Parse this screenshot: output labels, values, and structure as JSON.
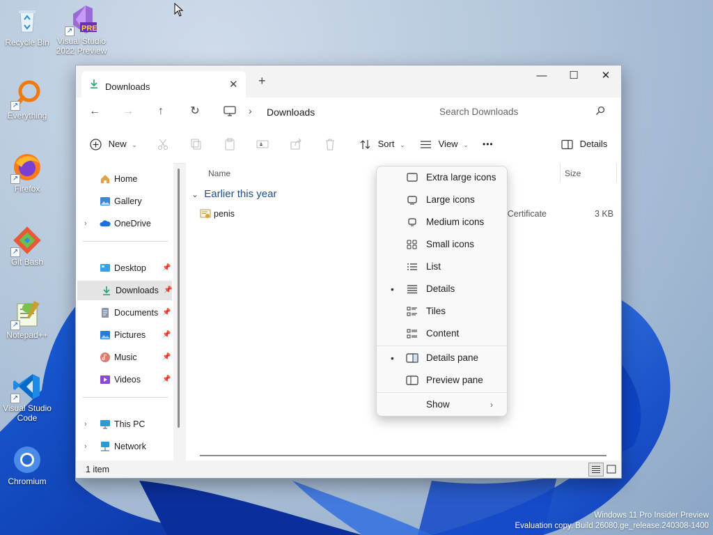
{
  "desktop": {
    "icons": [
      {
        "label": "Recycle Bin",
        "icon": "recycle-bin-icon"
      },
      {
        "label": "Visual Studio 2022 Preview",
        "badge": "PRE",
        "icon": "visual-studio-icon"
      },
      {
        "label": "Everything",
        "icon": "everything-search-icon"
      },
      {
        "label": "Firefox",
        "icon": "firefox-icon"
      },
      {
        "label": "Git Bash",
        "icon": "git-bash-icon"
      },
      {
        "label": "Notepad++",
        "icon": "notepad-plus-plus-icon"
      },
      {
        "label": "Visual Studio Code",
        "icon": "vscode-icon"
      },
      {
        "label": "Chromium",
        "icon": "chromium-icon"
      }
    ],
    "watermark": {
      "line1": "Windows 11 Pro Insider Preview",
      "line2": "Evaluation copy. Build 26080.ge_release.240308-1400"
    }
  },
  "explorer": {
    "tab_title": "Downloads",
    "tab_close": "✕",
    "new_tab": "+",
    "window_controls": {
      "minimize": "—",
      "maximize": "☐",
      "close": "✕"
    },
    "nav": {
      "back": "←",
      "forward": "→",
      "up": "↑",
      "refresh": "↻"
    },
    "address": {
      "separator": "›",
      "path": "Downloads"
    },
    "search": {
      "placeholder": "Search Downloads"
    },
    "commandbar": {
      "new_label": "New",
      "sort_label": "Sort",
      "view_label": "View",
      "more_label": "•••",
      "details_label": "Details",
      "dropdown_chevron": "⌄"
    },
    "sidebar": {
      "pin": "📌",
      "expand": "›",
      "items": [
        {
          "label": "Home",
          "icon": "home-icon"
        },
        {
          "label": "Gallery",
          "icon": "gallery-icon"
        },
        {
          "label": "OneDrive",
          "icon": "onedrive-icon"
        },
        {
          "label": "Desktop",
          "icon": "desktop-folder-icon"
        },
        {
          "label": "Downloads",
          "icon": "downloads-icon",
          "selected": true
        },
        {
          "label": "Documents",
          "icon": "documents-icon"
        },
        {
          "label": "Pictures",
          "icon": "pictures-icon"
        },
        {
          "label": "Music",
          "icon": "music-icon"
        },
        {
          "label": "Videos",
          "icon": "videos-icon"
        },
        {
          "label": "This PC",
          "icon": "this-pc-icon"
        },
        {
          "label": "Network",
          "icon": "network-icon"
        }
      ]
    },
    "columns": {
      "name": "Name",
      "size": "Size"
    },
    "group_chevron": "⌄",
    "group_header": "Earlier this year",
    "files": [
      {
        "name": "penis",
        "type_partial": "y Certificate",
        "size": "3 KB",
        "icon": "certificate-file-icon"
      }
    ],
    "status": {
      "count": "1 item"
    },
    "view_menu": {
      "bullet": "•",
      "submenu_arrow": "›",
      "items": [
        {
          "label": "Extra large icons",
          "icon": "extra-large-icons-icon",
          "checked": false
        },
        {
          "label": "Large icons",
          "icon": "large-icons-icon",
          "checked": false
        },
        {
          "label": "Medium icons",
          "icon": "medium-icons-icon",
          "checked": false
        },
        {
          "label": "Small icons",
          "icon": "small-icons-icon",
          "checked": false
        },
        {
          "label": "List",
          "icon": "list-view-icon",
          "checked": false
        },
        {
          "label": "Details",
          "icon": "details-view-icon",
          "checked": true
        },
        {
          "label": "Tiles",
          "icon": "tiles-view-icon",
          "checked": false
        },
        {
          "label": "Content",
          "icon": "content-view-icon",
          "checked": false
        },
        {
          "label": "Details pane",
          "icon": "details-pane-icon",
          "checked": true
        },
        {
          "label": "Preview pane",
          "icon": "preview-pane-icon",
          "checked": false
        },
        {
          "label": "Show",
          "icon": "",
          "checked": false,
          "submenu": true
        }
      ]
    }
  },
  "colors": {
    "accent": "#0067c0",
    "group_header": "#1f4e8c",
    "downloads_arrow": "#2e9e6e"
  }
}
